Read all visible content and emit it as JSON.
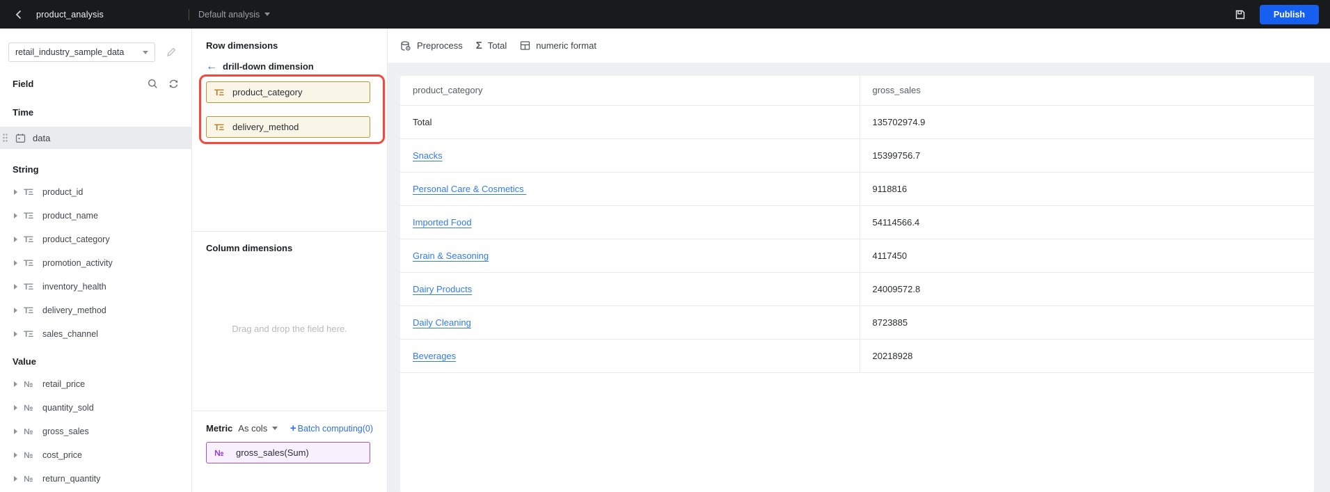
{
  "topbar": {
    "title": "product_analysis",
    "analysis_label": "Default analysis",
    "publish_label": "Publish"
  },
  "colors": {
    "publish_blue": "#1560f0",
    "link_blue": "#3179f5",
    "accent_blue": "#2e6ef2",
    "highlight_red": "#f5483d",
    "dim_chip_border": "#bb9733",
    "dim_chip_bg": "#f9f5e7",
    "metric_chip_border": "#a052de",
    "metric_chip_bg": "#f8f1fd",
    "topbar_bg": "#191a1c"
  },
  "icons": {
    "string_type": "TΞ",
    "number_type": "№",
    "sigma": "Σ",
    "arrow_left": "←",
    "plus": "+"
  },
  "sidebar": {
    "dataset": "retail_industry_sample_data",
    "field_label": "Field",
    "time_section": "Time",
    "time_field": "data",
    "string_section": "String",
    "string_fields": [
      {
        "name": "product_id"
      },
      {
        "name": "product_name"
      },
      {
        "name": "product_category"
      },
      {
        "name": "promotion_activity"
      },
      {
        "name": "inventory_health"
      },
      {
        "name": "delivery_method"
      },
      {
        "name": "sales_channel"
      }
    ],
    "value_section": "Value",
    "value_fields": [
      {
        "name": "retail_price"
      },
      {
        "name": "quantity_sold"
      },
      {
        "name": "gross_sales"
      },
      {
        "name": "cost_price"
      },
      {
        "name": "return_quantity"
      }
    ]
  },
  "panel": {
    "row_dimensions_label": "Row dimensions",
    "drill_down_label": "drill-down dimension",
    "row_chips": [
      {
        "label": "product_category"
      },
      {
        "label": "delivery_method"
      }
    ],
    "column_dimensions_label": "Column dimensions",
    "drop_placeholder": "Drag and drop the field here.",
    "metric_label": "Metric",
    "metric_mode": "As cols",
    "batch_label": "Batch computing(0)",
    "metric_chip": "gross_sales(Sum)"
  },
  "toolbar": {
    "preprocess_label": "Preprocess",
    "total_label": "Total",
    "numeric_format_label": "numeric format"
  },
  "table": {
    "columns": [
      "product_category",
      "gross_sales"
    ],
    "rows": [
      {
        "category": "Total",
        "value": "135702974.9"
      },
      {
        "category": "Snacks",
        "value": "15399756.7"
      },
      {
        "category": "Personal Care & Cosmetics ",
        "value": "9118816"
      },
      {
        "category": "Imported Food",
        "value": "54114566.4"
      },
      {
        "category": "Grain & Seasoning",
        "value": "4117450"
      },
      {
        "category": "Dairy Products",
        "value": "24009572.8"
      },
      {
        "category": "Daily Cleaning",
        "value": "8723885"
      },
      {
        "category": "Beverages",
        "value": "20218928"
      }
    ]
  }
}
